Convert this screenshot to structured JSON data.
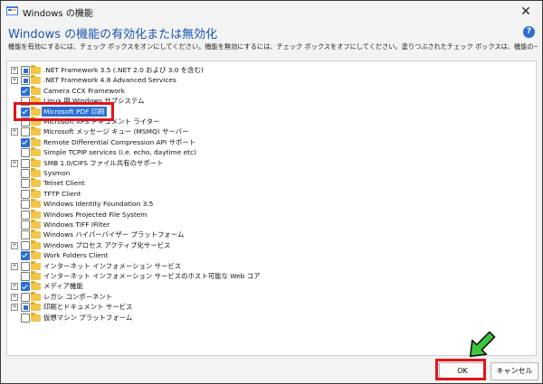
{
  "window": {
    "title": "Windows の機能",
    "close_glyph": "✕",
    "heading": "Windows の機能の有効化または無効化",
    "help_glyph": "?",
    "description": "機能を有効にするには、チェック ボックスをオンにしてください。機能を無効にするには、チェック ボックスをオフにしてください。塗りつぶされたチェック ボックスは、機能の一部が有効になっていることを表します。"
  },
  "features": [
    {
      "label": ".NET Framework 3.5 (.NET 2.0 および 3.0 を含む)",
      "expander": "+",
      "state": "partial"
    },
    {
      "label": ".NET Framework 4.8 Advanced Services",
      "expander": "+",
      "state": "partial"
    },
    {
      "label": "Camera CCX Framework",
      "expander": "",
      "state": "checked"
    },
    {
      "label": "Linux 用 Windows サブシステム",
      "expander": "",
      "state": "unchecked"
    },
    {
      "label": "Microsoft PDF 印刷",
      "expander": "",
      "state": "checked",
      "selected": true
    },
    {
      "label": "Microsoft XPS ドキュメント ライター",
      "expander": "",
      "state": "unchecked"
    },
    {
      "label": "Microsoft メッセージ キュー (MSMQ) サーバー",
      "expander": "+",
      "state": "unchecked"
    },
    {
      "label": "Remote Differential Compression API サポート",
      "expander": "",
      "state": "checked"
    },
    {
      "label": "Simple TCPIP services (i.e. echo, daytime etc)",
      "expander": "",
      "state": "unchecked"
    },
    {
      "label": "SMB 1.0/CIFS ファイル共有のサポート",
      "expander": "+",
      "state": "unchecked"
    },
    {
      "label": "Sysmon",
      "expander": "",
      "state": "unchecked"
    },
    {
      "label": "Telnet Client",
      "expander": "",
      "state": "unchecked"
    },
    {
      "label": "TFTP Client",
      "expander": "",
      "state": "unchecked"
    },
    {
      "label": "Windows Identity Foundation 3.5",
      "expander": "",
      "state": "unchecked"
    },
    {
      "label": "Windows Projected File System",
      "expander": "",
      "state": "unchecked"
    },
    {
      "label": "Windows TIFF IFilter",
      "expander": "",
      "state": "unchecked"
    },
    {
      "label": "Windows ハイパーバイザー プラットフォーム",
      "expander": "",
      "state": "unchecked"
    },
    {
      "label": "Windows プロセス アクティブ化サービス",
      "expander": "+",
      "state": "unchecked"
    },
    {
      "label": "Work Folders Client",
      "expander": "",
      "state": "checked"
    },
    {
      "label": "インターネット インフォメーション サービス",
      "expander": "+",
      "state": "unchecked"
    },
    {
      "label": "インターネット インフォメーション サービスのホスト可能な Web コア",
      "expander": "",
      "state": "unchecked"
    },
    {
      "label": "メディア機能",
      "expander": "+",
      "state": "checked"
    },
    {
      "label": "レガシ コンポーネント",
      "expander": "+",
      "state": "unchecked"
    },
    {
      "label": "印刷とドキュメント サービス",
      "expander": "+",
      "state": "partial"
    },
    {
      "label": "仮想マシン プラットフォーム",
      "expander": "",
      "state": "unchecked"
    }
  ],
  "buttons": {
    "ok": "OK",
    "cancel": "キャンセル"
  },
  "colors": {
    "accent": "#2a6fd6",
    "annotation_red": "#e0141c",
    "annotation_arrow": "#3cc63c",
    "heading_blue": "#1a56b0"
  }
}
